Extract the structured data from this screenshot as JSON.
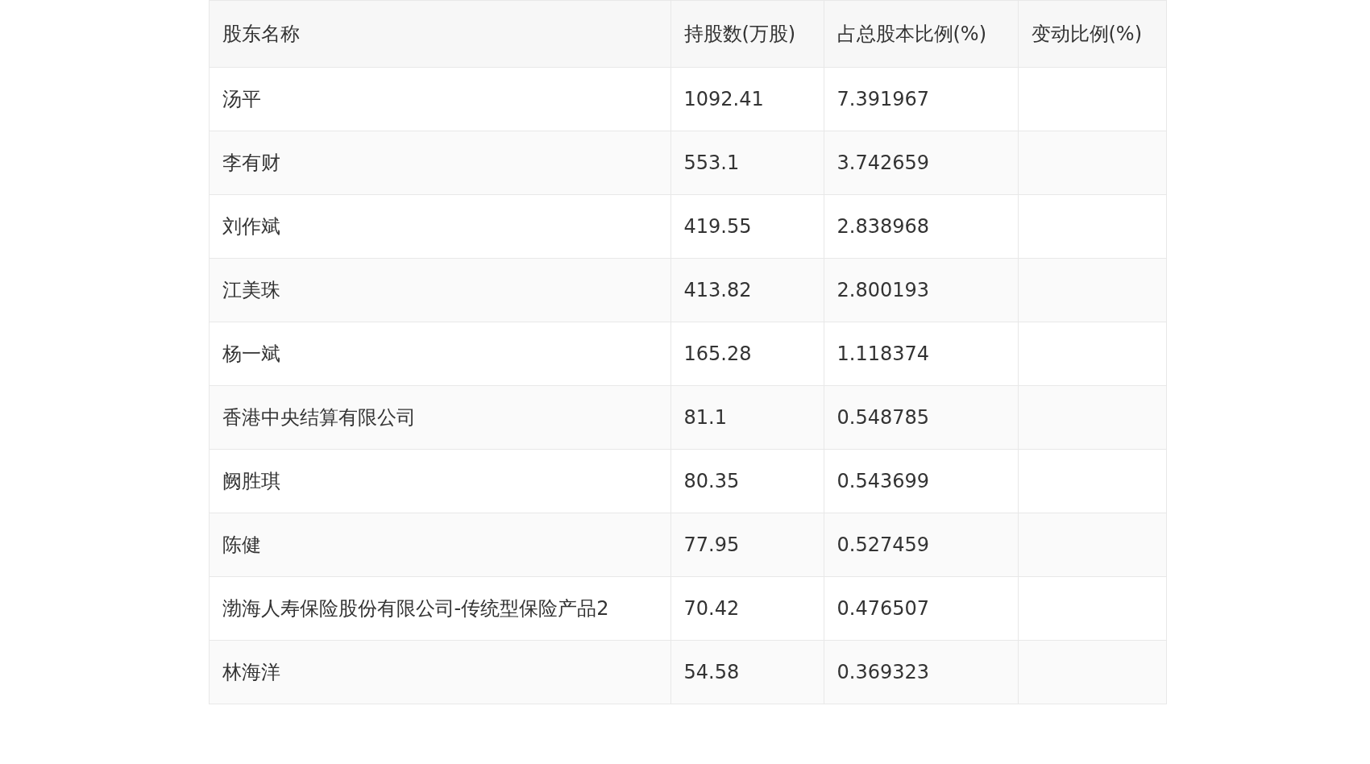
{
  "table": {
    "columns": [
      "股东名称",
      "持股数(万股)",
      "占总股本比例(%)",
      "变动比例(%)"
    ],
    "rows": [
      [
        "汤平",
        "1092.41",
        "7.391967",
        ""
      ],
      [
        "李有财",
        "553.1",
        "3.742659",
        ""
      ],
      [
        "刘作斌",
        "419.55",
        "2.838968",
        ""
      ],
      [
        "江美珠",
        "413.82",
        "2.800193",
        ""
      ],
      [
        "杨一斌",
        "165.28",
        "1.118374",
        ""
      ],
      [
        "香港中央结算有限公司",
        "81.1",
        "0.548785",
        ""
      ],
      [
        "阙胜琪",
        "80.35",
        "0.543699",
        ""
      ],
      [
        "陈健",
        "77.95",
        "0.527459",
        ""
      ],
      [
        "渤海人寿保险股份有限公司-传统型保险产品2",
        "70.42",
        "0.476507",
        ""
      ],
      [
        "林海洋",
        "54.58",
        "0.369323",
        ""
      ]
    ]
  }
}
